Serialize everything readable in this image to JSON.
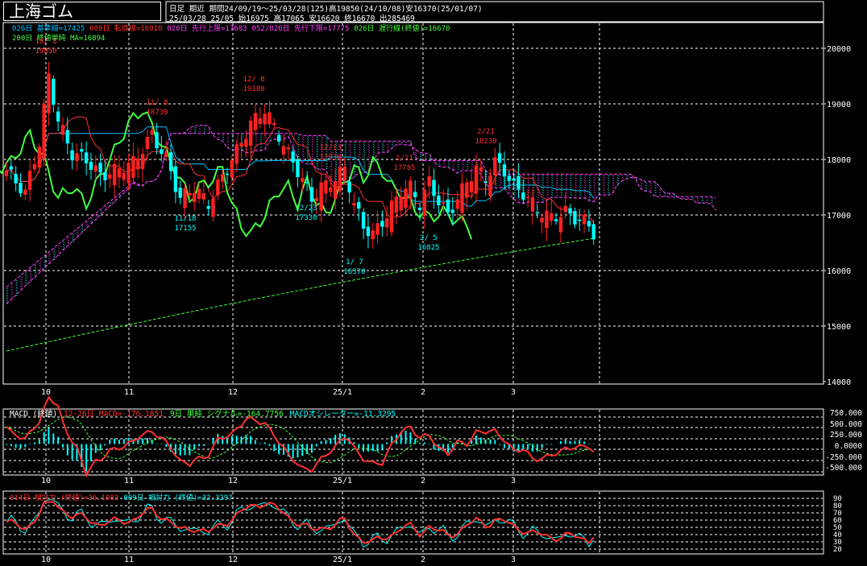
{
  "title": "上海ゴム",
  "header": {
    "info_line1": "日足 期近 期間24/09/19～25/03/28(125)高19850(24/10/08)安16370(25/01/07)",
    "info_line2": "25/03/28 25/05 始16975 高17065 安16620 終16670 出285469",
    "legend_line1": [
      {
        "text": "026日 基準線=17425",
        "color": "#00bfff"
      },
      {
        "text": "009日 転換線=16910",
        "color": "#ff3030"
      },
      {
        "text": "026日 先行上限=17603",
        "color": "#ff40ff"
      },
      {
        "text": "052/026日 先行下限=17775",
        "color": "#ff40ff"
      },
      {
        "text": "026日 遅行線(終値)=16670",
        "color": "#40ff40"
      }
    ],
    "legend_line2": [
      {
        "text": "200日 終値単純 MA=16894",
        "color": "#40ff40"
      }
    ]
  },
  "main_axis": {
    "ticks": [
      "20000",
      "19000",
      "18000",
      "17000",
      "16000",
      "15000",
      "14000"
    ]
  },
  "x_ticks": [
    "10",
    "11",
    "12",
    "25/1",
    "2",
    "3"
  ],
  "annotations": [
    {
      "text": "10/ 8",
      "color": "#ff3030"
    },
    {
      "text": "19850",
      "color": "#ff3030"
    },
    {
      "text": "11/ 8",
      "color": "#ff3030"
    },
    {
      "text": "18730",
      "color": "#ff3030"
    },
    {
      "text": "12/ 8",
      "color": "#ff3030"
    },
    {
      "text": "19180",
      "color": "#ff3030"
    },
    {
      "text": "12/13",
      "color": "#ff3030"
    },
    {
      "text": "17930",
      "color": "#ff3030"
    },
    {
      "text": "1/21",
      "color": "#ff3030"
    },
    {
      "text": "17785",
      "color": "#ff3030"
    },
    {
      "text": "2/21",
      "color": "#ff3030"
    },
    {
      "text": "18230",
      "color": "#ff3030"
    },
    {
      "text": "11/18",
      "color": "#00ffff"
    },
    {
      "text": "17155",
      "color": "#00ffff"
    },
    {
      "text": "12/23",
      "color": "#00ffff"
    },
    {
      "text": "17330",
      "color": "#00ffff"
    },
    {
      "text": "1/ 7",
      "color": "#00ffff"
    },
    {
      "text": "16370",
      "color": "#00ffff"
    },
    {
      "text": "2/ 5",
      "color": "#00ffff"
    },
    {
      "text": "16825",
      "color": "#00ffff"
    }
  ],
  "macd_panel": {
    "legend": [
      {
        "text": "MACD (終値)",
        "color": "#ffffff"
      },
      {
        "text": "12-26日 MACD=-176.1851",
        "color": "#ff3030"
      },
      {
        "text": "9日 単純 シグナル=-164.7756",
        "color": "#40ff40"
      },
      {
        "text": "MACDオシレーター=-11.3295",
        "color": "#00ffff"
      }
    ],
    "axis_ticks": [
      "750.000",
      "500.000",
      "250.000",
      "0.0000",
      "-250.000",
      "-500.000"
    ]
  },
  "rsi_panel": {
    "legend": [
      {
        "text": "014日 相対力 (終値)=36.1082",
        "color": "#ff3030"
      },
      {
        "text": "009日 相対力 (終値)=32.3297",
        "color": "#00ffff"
      }
    ],
    "axis_ticks": [
      "90",
      "80",
      "70",
      "60",
      "50",
      "40",
      "30",
      "20"
    ]
  },
  "colors": {
    "up": "#ff2020",
    "down": "#00ffff",
    "grid": "#ffffff",
    "cloud": "#ff40ff",
    "chikou": "#40ff40",
    "ma": "#40ff40"
  },
  "chart_data": {
    "type": "candlestick",
    "x": [
      "2024-09-19",
      "2024-10-01",
      "2024-10-08",
      "2024-11-01",
      "2024-11-08",
      "2024-11-18",
      "2024-12-02",
      "2024-12-09",
      "2024-12-13",
      "2024-12-23",
      "2025-01-02",
      "2025-01-07",
      "2025-01-21",
      "2025-02-03",
      "2025-02-05",
      "2025-02-21",
      "2025-03-03",
      "2025-03-28"
    ],
    "close": [
      17800,
      17700,
      19500,
      18100,
      18650,
      17300,
      17700,
      18900,
      17850,
      17450,
      17100,
      16500,
      17600,
      17400,
      17000,
      17900,
      17500,
      16670
    ],
    "highs": {
      "2024-10-08": 19850,
      "2024-11-08": 18730,
      "2024-12-09": 19180,
      "2024-12-13": 17930,
      "2025-01-21": 17785,
      "2025-02-21": 18230
    },
    "lows": {
      "2024-11-18": 17155,
      "2024-12-23": 17330,
      "2025-01-07": 16370,
      "2025-02-05": 16825
    },
    "ylim": [
      14000,
      20300
    ],
    "macd": {
      "macd": -176.1851,
      "signal": -164.7756,
      "oscillator": -11.3295,
      "ylim": [
        -500,
        750
      ]
    },
    "rsi": {
      "rsi14": 36.1082,
      "rsi9": 32.3297,
      "ylim": [
        20,
        90
      ]
    }
  }
}
